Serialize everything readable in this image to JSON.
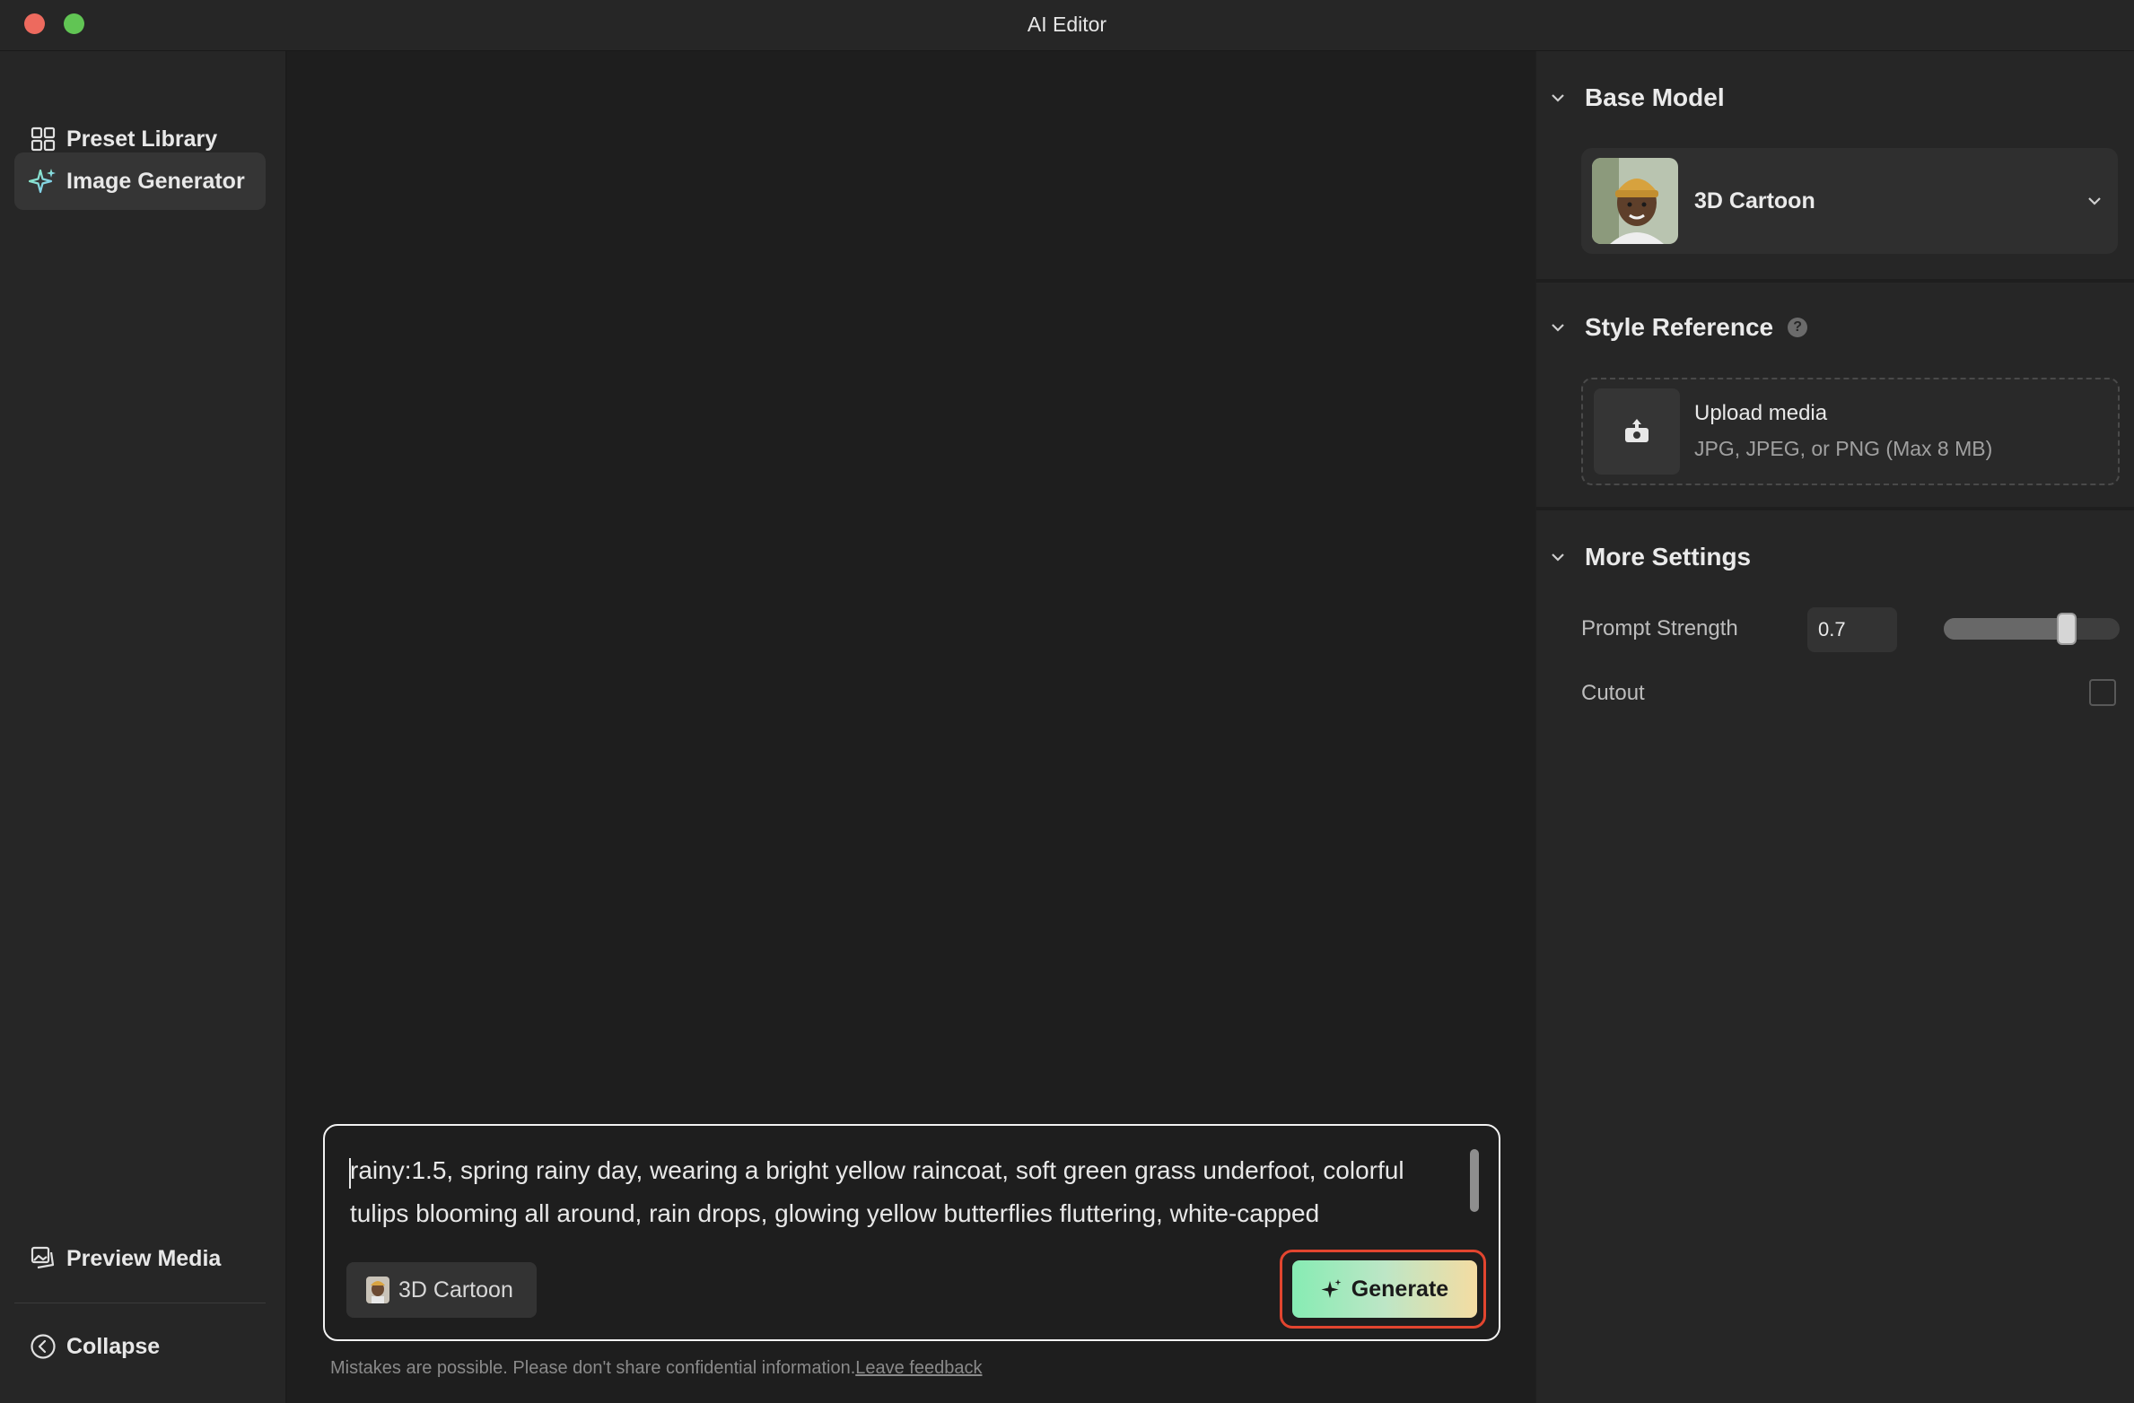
{
  "window": {
    "title": "AI Editor"
  },
  "sidebar": {
    "items": [
      {
        "label": "Preset Library",
        "icon": "grid-icon"
      },
      {
        "label": "Image Generator",
        "icon": "sparkle-icon",
        "active": true
      }
    ],
    "bottom": [
      {
        "label": "Preview Media",
        "icon": "images-icon"
      },
      {
        "label": "Collapse",
        "icon": "chevron-left-circle-icon"
      }
    ]
  },
  "prompt": {
    "text": "rainy:1.5, spring rainy day, wearing a bright yellow raincoat, soft green grass underfoot, colorful tulips blooming all around, rain drops, glowing yellow butterflies fluttering, white-capped",
    "model_chip": "3D Cartoon",
    "generate_label": "Generate"
  },
  "disclaimer": {
    "text": "Mistakes are possible. Please don't share confidential information.",
    "link": "Leave feedback"
  },
  "panel": {
    "base_model": {
      "title": "Base Model",
      "selected": "3D Cartoon"
    },
    "style_reference": {
      "title": "Style Reference",
      "help": "?",
      "upload_title": "Upload media",
      "upload_sub": "JPG, JPEG, or PNG (Max 8 MB)"
    },
    "more_settings": {
      "title": "More Settings",
      "prompt_strength_label": "Prompt Strength",
      "prompt_strength_value": "0.7",
      "prompt_strength": 0.7,
      "cutout_label": "Cutout",
      "cutout_checked": false
    }
  },
  "colors": {
    "accent_ring": "#e2452f",
    "generate_gradient_start": "#86ecb3",
    "generate_gradient_end": "#f4dca2"
  }
}
